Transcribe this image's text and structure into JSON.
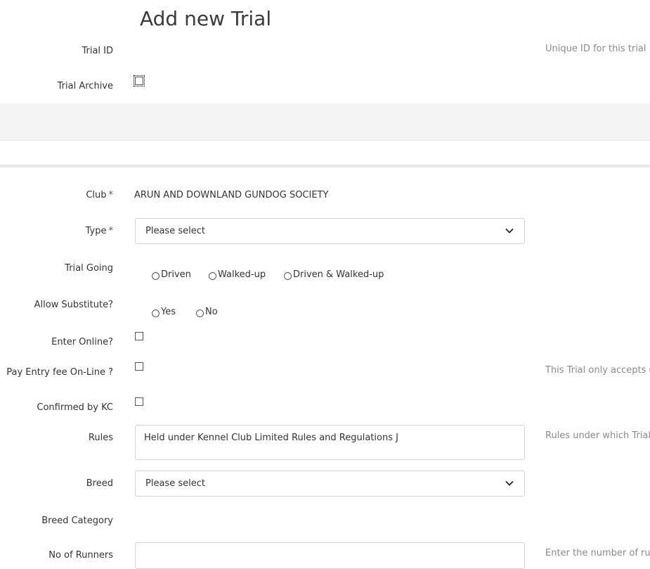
{
  "page": {
    "title": "Add new Trial"
  },
  "trial_id": {
    "label": "Trial ID",
    "help": "Unique ID for this trial"
  },
  "trial_archive": {
    "label": "Trial Archive"
  },
  "club": {
    "label": "Club",
    "required": "*",
    "value": "ARUN AND DOWNLAND GUNDOG SOCIETY"
  },
  "type": {
    "label": "Type",
    "required": "*",
    "selected": "Please select"
  },
  "trial_going": {
    "label": "Trial Going",
    "options": [
      "Driven",
      "Walked-up",
      "Driven & Walked-up"
    ]
  },
  "allow_substitute": {
    "label": "Allow Substitute?",
    "options": [
      "Yes",
      "No"
    ]
  },
  "enter_online": {
    "label": "Enter Online?"
  },
  "pay_entry": {
    "label": "Pay Entry fee On-Line ?",
    "help": "This Trial only accepts on"
  },
  "confirmed_kc": {
    "label": "Confirmed by KC"
  },
  "rules": {
    "label": "Rules",
    "value": "Held under Kennel Club Limited Rules and Regulations J",
    "help": "Rules under which Trial is"
  },
  "breed": {
    "label": "Breed",
    "selected": "Please select"
  },
  "breed_category": {
    "label": "Breed Category"
  },
  "no_of_runners": {
    "label": "No of Runners",
    "help": "Enter the number of runn"
  },
  "icons": {
    "chevron": "chevron-down-icon"
  }
}
